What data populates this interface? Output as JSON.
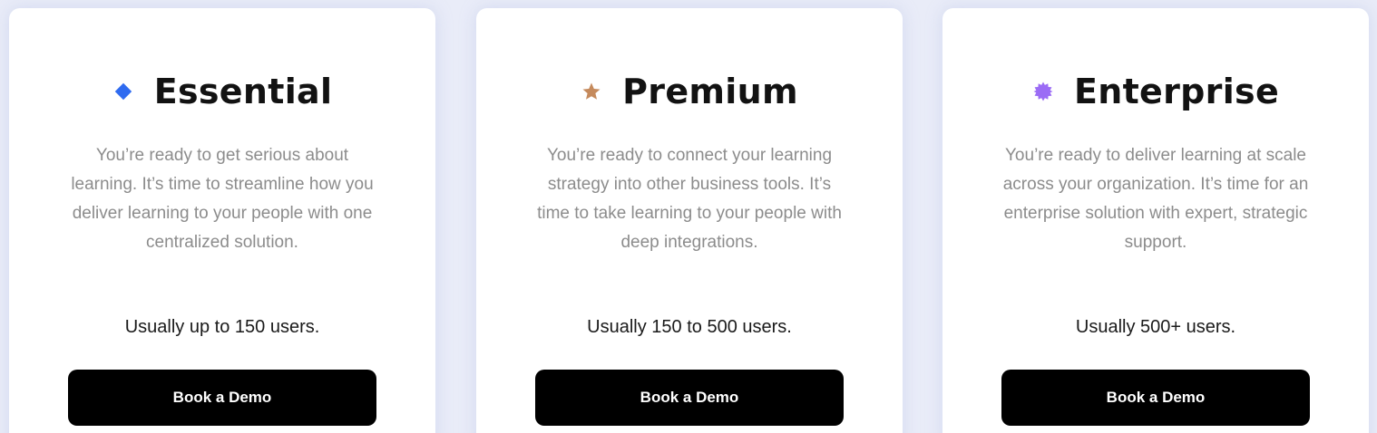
{
  "plans": [
    {
      "icon": "diamond-icon",
      "icon_color": "#2f6bf0",
      "title": "Essential",
      "description": "You’re ready to get serious about learning. It’s time to streamline how you deliver learning to your people with one centralized solution.",
      "users": "Usually up to 150 users.",
      "button_label": "Book a Demo"
    },
    {
      "icon": "star-icon",
      "icon_color": "#c58a5c",
      "title": "Premium",
      "description": "You’re ready to connect your learning strategy into other business tools. It’s time to take learning to your people with deep integrations.",
      "users": "Usually 150 to 500 users.",
      "button_label": "Book a Demo"
    },
    {
      "icon": "badge-icon",
      "icon_color": "#9b6cf5",
      "title": "Enterprise",
      "description": "You’re ready to deliver learning at scale across your organization. It’s time for an enterprise solution with expert, strategic support.",
      "users": "Usually 500+ users.",
      "button_label": "Book a Demo"
    }
  ]
}
